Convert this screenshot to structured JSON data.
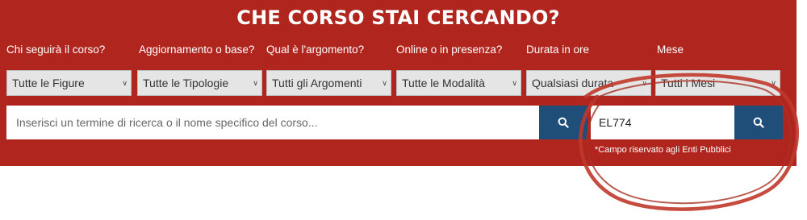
{
  "header": {
    "title": "CHE CORSO STAI CERCANDO?"
  },
  "filters": [
    {
      "label": "Chi seguirà il corso?",
      "value": "Tutte le Figure"
    },
    {
      "label": "Aggiornamento o base?",
      "value": "Tutte le Tipologie"
    },
    {
      "label": "Qual è l'argomento?",
      "value": "Tutti gli Argomenti"
    },
    {
      "label": "Online o in presenza?",
      "value": "Tutte le Modalità"
    },
    {
      "label": "Durata in ore",
      "value": "Qualsiasi durata"
    },
    {
      "label": "Mese",
      "value": "Tutti i Mesi"
    }
  ],
  "search": {
    "placeholder": "Inserisci un termine di ricerca o il nome specifico del corso..."
  },
  "code_search": {
    "value": "EL774",
    "note": "*Campo riservato agli Enti Pubblici"
  },
  "colors": {
    "panel": "#b0261e",
    "button": "#1f4e79",
    "annotation": "#c0392b"
  },
  "icons": {
    "search_button": "search-icon",
    "select": "chevron-down-icon"
  }
}
